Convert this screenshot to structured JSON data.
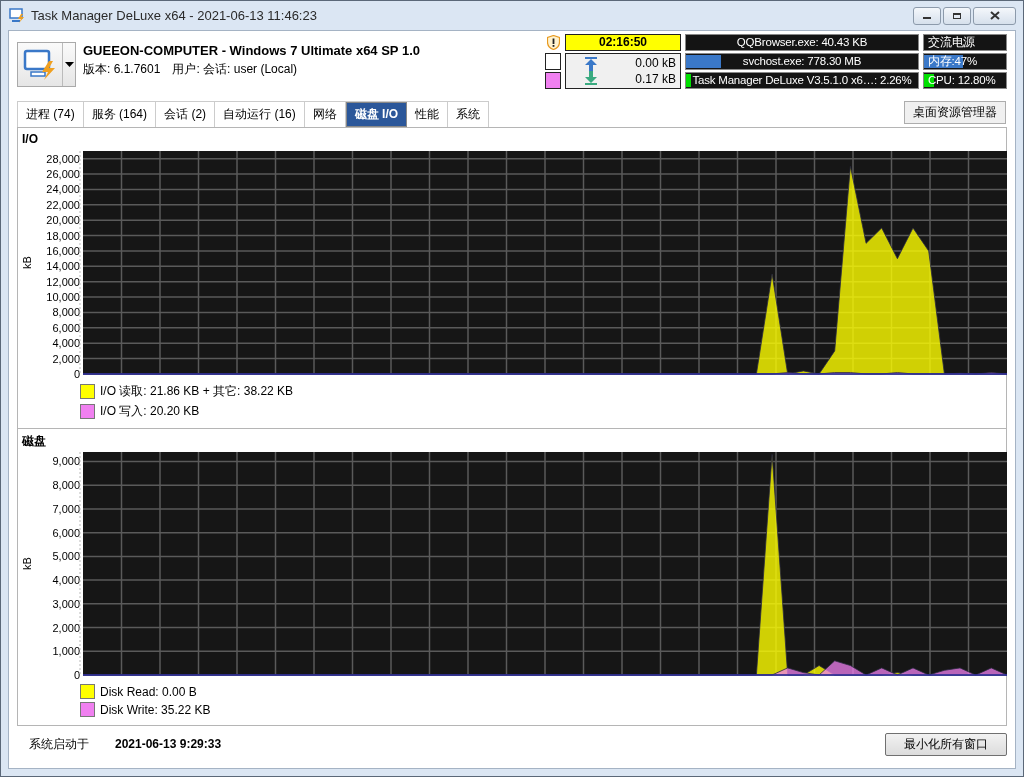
{
  "window": {
    "title": "Task Manager DeLuxe x64 - 2021-06-13 11:46:23"
  },
  "header": {
    "computer_name": "GUEEON-COMPUTER - Windows 7 Ultimate x64 SP 1.0",
    "version": "版本: 6.1.7601",
    "user": "用户: 会话: user (Local)",
    "timer": "02:16:50",
    "network": [
      {
        "reading": "0.00 kB",
        "color": "#ffffff"
      },
      {
        "reading": "0.17 kB",
        "color": "#f080f0"
      }
    ],
    "top_processes": [
      {
        "label": "QQBrowser.exe: 40.43 KB"
      },
      {
        "label": "svchost.exe: 778.30 MB",
        "level": 0.15
      },
      {
        "label": "Task Manager DeLuxe V3.5.1.0 x6…: 2.26%",
        "level": 0.02
      }
    ],
    "system": [
      {
        "kind": "text",
        "label": "交流电源"
      },
      {
        "kind": "memory",
        "label": "内存:47%",
        "level": 0.47
      },
      {
        "kind": "cpu",
        "label": "CPU: 12.80%",
        "level": 0.128
      }
    ]
  },
  "tabs": [
    {
      "label": "进程 (74)",
      "selected": false
    },
    {
      "label": "服务 (164)",
      "selected": false
    },
    {
      "label": "会话 (2)",
      "selected": false
    },
    {
      "label": "自动运行 (16)",
      "selected": false
    },
    {
      "label": "网络",
      "selected": false
    },
    {
      "label": "磁盘 I/O",
      "selected": true
    },
    {
      "label": "性能",
      "selected": false
    },
    {
      "label": "系统",
      "selected": false
    }
  ],
  "desktop_button": "桌面资源管理器",
  "charts": [
    {
      "title": "I/O",
      "chart_data": {
        "type": "area",
        "grid": true,
        "ylabel": "kB",
        "ylim": [
          0,
          29000
        ],
        "yticks": [
          {
            "value": 0,
            "label": "0"
          },
          {
            "value": 2000,
            "label": "2,000"
          },
          {
            "value": 4000,
            "label": "4,000"
          },
          {
            "value": 6000,
            "label": "6,000"
          },
          {
            "value": 8000,
            "label": "8,000"
          },
          {
            "value": 10000,
            "label": "10,000"
          },
          {
            "value": 12000,
            "label": "12,000"
          },
          {
            "value": 14000,
            "label": "14,000"
          },
          {
            "value": 16000,
            "label": "16,000"
          },
          {
            "value": 18000,
            "label": "18,000"
          },
          {
            "value": 20000,
            "label": "20,000"
          },
          {
            "value": 22000,
            "label": "22,000"
          },
          {
            "value": 24000,
            "label": "24,000"
          },
          {
            "value": 26000,
            "label": "26,000"
          },
          {
            "value": 28000,
            "label": "28,000"
          }
        ],
        "series": [
          {
            "name": "I/O 读取: 21.86 KB + 其它: 38.22 KB",
            "color": "#ffff00",
            "values": [
              0,
              0,
              0,
              0,
              0,
              0,
              0,
              0,
              0,
              0,
              0,
              0,
              0,
              0,
              0,
              0,
              0,
              0,
              0,
              0,
              0,
              0,
              0,
              0,
              0,
              0,
              0,
              0,
              0,
              0,
              0,
              0,
              0,
              0,
              0,
              0,
              0,
              0,
              0,
              0,
              0,
              0,
              0,
              0,
              13000,
              0,
              400,
              0,
              3000,
              27000,
              17000,
              19000,
              15000,
              19000,
              16000,
              0,
              0,
              0,
              0,
              0
            ]
          },
          {
            "name": "I/O 写入: 20.20 KB",
            "color": "#f080f0",
            "values": [
              0,
              0,
              0,
              0,
              0,
              0,
              0,
              0,
              0,
              0,
              0,
              0,
              0,
              0,
              0,
              0,
              0,
              0,
              0,
              0,
              0,
              0,
              0,
              0,
              0,
              0,
              0,
              0,
              0,
              0,
              0,
              0,
              0,
              0,
              0,
              0,
              0,
              0,
              0,
              0,
              0,
              0,
              0,
              0,
              0,
              200,
              0,
              0,
              200,
              200,
              0,
              0,
              200,
              0,
              0,
              0,
              100,
              0,
              200,
              0
            ]
          }
        ]
      }
    },
    {
      "title": "磁盘",
      "chart_data": {
        "type": "area",
        "grid": true,
        "ylabel": "kB",
        "ylim": [
          0,
          9400
        ],
        "yticks": [
          {
            "value": 0,
            "label": "0"
          },
          {
            "value": 1000,
            "label": "1,000"
          },
          {
            "value": 2000,
            "label": "2,000"
          },
          {
            "value": 3000,
            "label": "3,000"
          },
          {
            "value": 4000,
            "label": "4,000"
          },
          {
            "value": 5000,
            "label": "5,000"
          },
          {
            "value": 6000,
            "label": "6,000"
          },
          {
            "value": 7000,
            "label": "7,000"
          },
          {
            "value": 8000,
            "label": "8,000"
          },
          {
            "value": 9000,
            "label": "9,000"
          }
        ],
        "series": [
          {
            "name": "Disk Read: 0.00 B",
            "color": "#ffff00",
            "values": [
              0,
              0,
              0,
              0,
              0,
              0,
              0,
              0,
              0,
              0,
              0,
              0,
              0,
              0,
              0,
              0,
              0,
              0,
              0,
              0,
              0,
              0,
              0,
              0,
              0,
              0,
              0,
              0,
              0,
              0,
              0,
              0,
              0,
              0,
              0,
              0,
              0,
              0,
              0,
              0,
              0,
              0,
              0,
              0,
              9300,
              0,
              0,
              400,
              0,
              0,
              0,
              0,
              100,
              0,
              0,
              0,
              0,
              0,
              0,
              0
            ]
          },
          {
            "name": "Disk Write: 35.22 KB",
            "color": "#f080f0",
            "values": [
              0,
              0,
              0,
              0,
              0,
              0,
              0,
              0,
              0,
              0,
              0,
              0,
              0,
              0,
              0,
              0,
              0,
              0,
              0,
              0,
              0,
              0,
              0,
              0,
              0,
              0,
              0,
              0,
              0,
              0,
              0,
              0,
              0,
              0,
              0,
              0,
              0,
              0,
              0,
              0,
              0,
              0,
              0,
              0,
              0,
              300,
              100,
              0,
              600,
              400,
              0,
              300,
              0,
              300,
              0,
              200,
              300,
              0,
              300,
              0
            ]
          }
        ]
      }
    }
  ],
  "footer": {
    "boot_label": "系统启动于",
    "boot_time": "2021-06-13 9:29:33",
    "button": "最小化所有窗口"
  }
}
